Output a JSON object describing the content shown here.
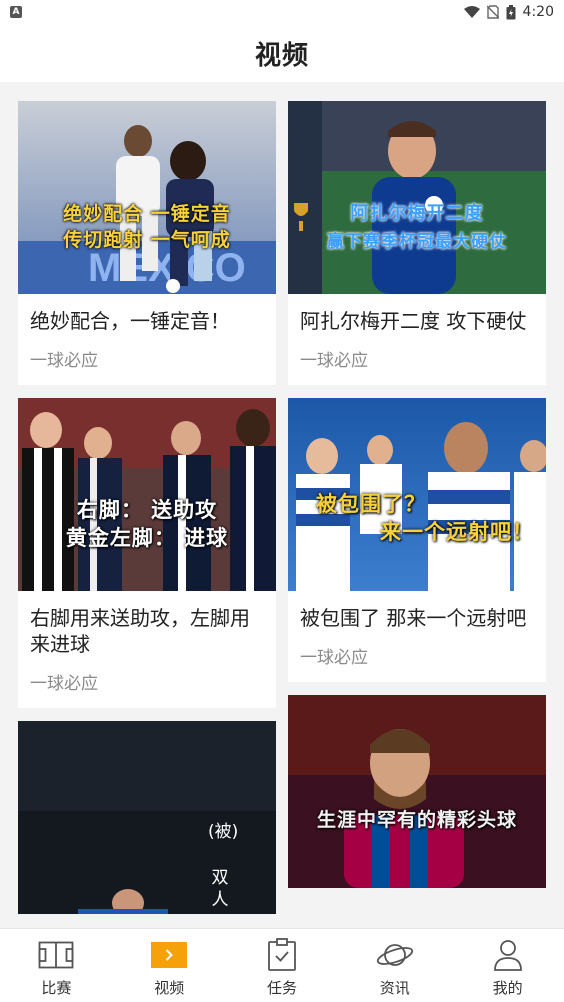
{
  "status_bar": {
    "time": "4:20"
  },
  "header": {
    "title": "视频"
  },
  "feed": {
    "left": [
      {
        "title": "绝妙配合，一锤定音！",
        "source": "一球必应",
        "caption": [
          "绝妙配合 一锤定音",
          "传切跑射 一气呵成"
        ]
      },
      {
        "title": "右脚用来送助攻，左脚用来进球",
        "source": "一球必应",
        "caption": [
          "右脚： 送助攻",
          "黄金左脚： 进球"
        ]
      },
      {
        "caption": [
          "(被)",
          "双人"
        ]
      }
    ],
    "right": [
      {
        "title": "阿扎尔梅开二度 攻下硬仗",
        "source": "一球必应",
        "caption": [
          "阿扎尔梅开二度",
          "赢下赛季杯冠最大硬仗"
        ]
      },
      {
        "title": "被包围了 那来一个远射吧",
        "source": "一球必应",
        "caption": [
          "被包围了？",
          "来一个远射吧！"
        ]
      },
      {
        "caption": [
          "生涯中罕有的精彩头球"
        ]
      }
    ]
  },
  "tabbar": {
    "items": [
      {
        "label": "比赛",
        "icon": "pitch-icon",
        "active": false
      },
      {
        "label": "视频",
        "icon": "play-icon",
        "active": true
      },
      {
        "label": "任务",
        "icon": "clipboard-check-icon",
        "active": false
      },
      {
        "label": "资讯",
        "icon": "planet-icon",
        "active": false
      },
      {
        "label": "我的",
        "icon": "user-icon",
        "active": false
      }
    ]
  },
  "colors": {
    "accent": "#f5a10a",
    "caption_yellow": "#f7d23a",
    "caption_blue": "#3aa0ff",
    "background": "#f3f3f3",
    "muted": "#8a8a8a"
  }
}
